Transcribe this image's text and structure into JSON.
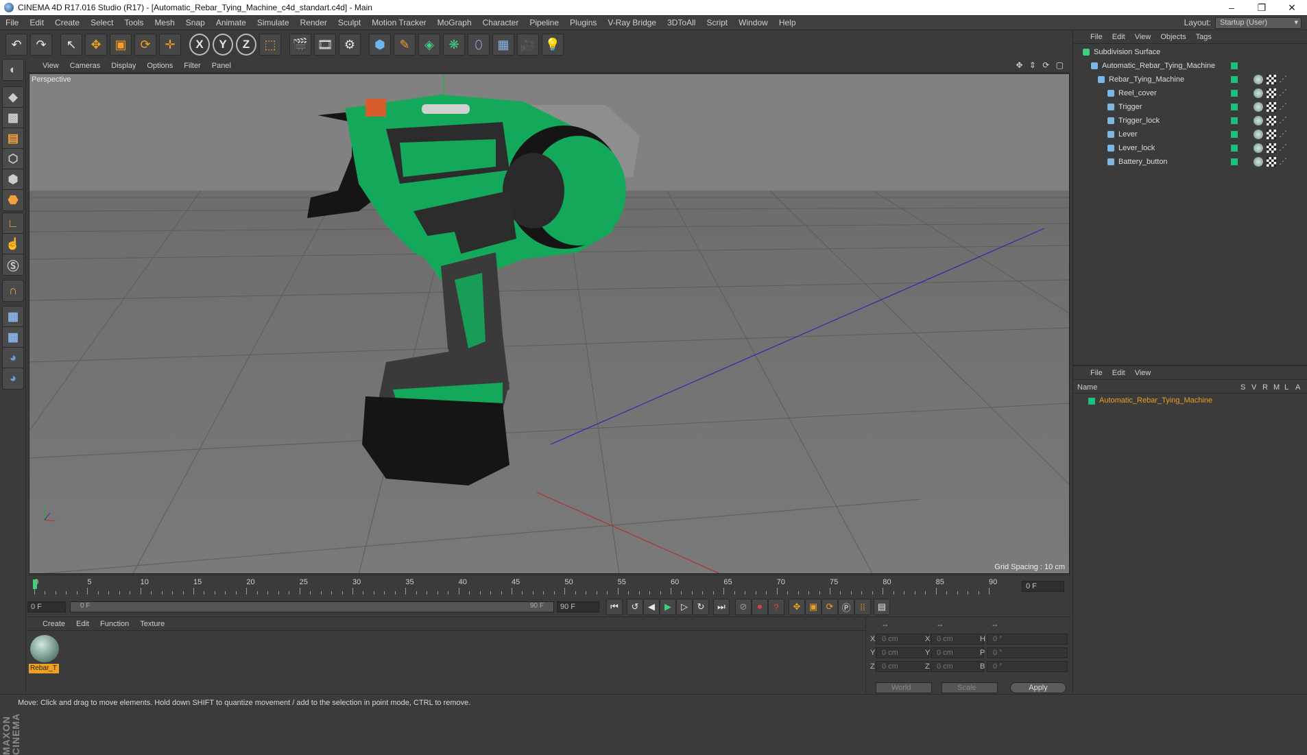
{
  "window": {
    "title": "CINEMA 4D R17.016 Studio (R17) - [Automatic_Rebar_Tying_Machine_c4d_standart.c4d] - Main"
  },
  "menubar": {
    "items": [
      "File",
      "Edit",
      "Create",
      "Select",
      "Tools",
      "Mesh",
      "Snap",
      "Animate",
      "Simulate",
      "Render",
      "Sculpt",
      "Motion Tracker",
      "MoGraph",
      "Character",
      "Pipeline",
      "Plugins",
      "V-Ray Bridge",
      "3DToAll",
      "Script",
      "Window",
      "Help"
    ]
  },
  "layout": {
    "label": "Layout:",
    "value": "Startup (User)"
  },
  "viewport": {
    "menu": [
      "View",
      "Cameras",
      "Display",
      "Options",
      "Filter",
      "Panel"
    ],
    "camera_label": "Perspective",
    "grid_spacing": "Grid Spacing : 10 cm"
  },
  "timeline": {
    "ticks": [
      "0",
      "5",
      "10",
      "15",
      "20",
      "25",
      "30",
      "35",
      "40",
      "45",
      "50",
      "55",
      "60",
      "65",
      "70",
      "75",
      "80",
      "85",
      "90"
    ],
    "current_frame": "0 F",
    "start_field": "0 F",
    "range_start": "0 F",
    "range_end": "90 F",
    "end_field": "90 F"
  },
  "materials": {
    "menu": [
      "Create",
      "Edit",
      "Function",
      "Texture"
    ],
    "items": [
      {
        "label": "Rebar_T"
      }
    ]
  },
  "coordinates": {
    "headers": [
      "--",
      "--",
      "--"
    ],
    "rows": [
      {
        "a": "X",
        "v1": "0 cm",
        "b": "X",
        "v2": "0 cm",
        "c": "H",
        "v3": "0 °"
      },
      {
        "a": "Y",
        "v1": "0 cm",
        "b": "Y",
        "v2": "0 cm",
        "c": "P",
        "v3": "0 °"
      },
      {
        "a": "Z",
        "v1": "0 cm",
        "b": "Z",
        "v2": "0 cm",
        "c": "B",
        "v3": "0 °"
      }
    ],
    "world": "World",
    "scale": "Scale",
    "apply": "Apply"
  },
  "object_manager": {
    "menu": [
      "File",
      "Edit",
      "View",
      "Objects",
      "Tags"
    ],
    "objects": [
      {
        "name": "Subdivision Surface"
      },
      {
        "name": "Automatic_Rebar_Tying_Machine"
      },
      {
        "name": "Rebar_Tying_Machine"
      },
      {
        "name": "Reel_cover"
      },
      {
        "name": "Trigger"
      },
      {
        "name": "Trigger_lock"
      },
      {
        "name": "Lever"
      },
      {
        "name": "Lever_lock"
      },
      {
        "name": "Battery_button"
      }
    ]
  },
  "layer_manager": {
    "menu": [
      "File",
      "Edit",
      "View"
    ],
    "columns": {
      "name": "Name",
      "flags": [
        "S",
        "V",
        "R",
        "M",
        "L",
        "A"
      ]
    },
    "layer": "Automatic_Rebar_Tying_Machine"
  },
  "status": {
    "text": "Move: Click and drag to move elements. Hold down SHIFT to quantize movement / add to the selection in point mode, CTRL to remove."
  },
  "colors": {
    "accent": "#f0a020",
    "layer_green": "#18c27a",
    "machine_green": "#14a85a"
  }
}
